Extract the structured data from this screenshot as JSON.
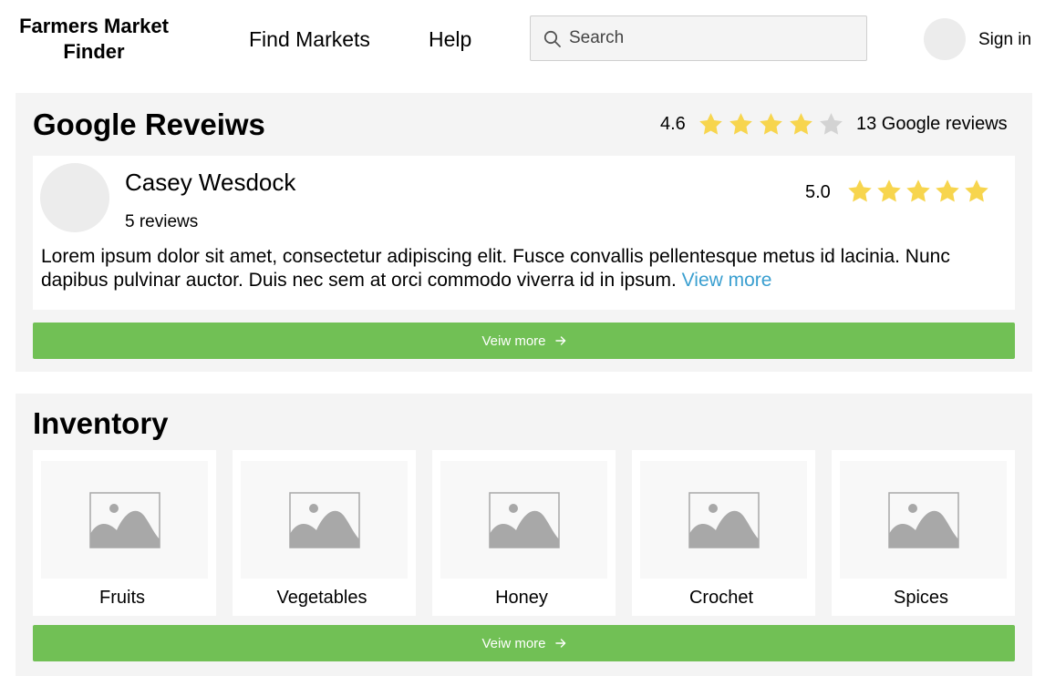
{
  "header": {
    "brand_line1": "Farmers Market",
    "brand_line2": "Finder",
    "nav": [
      {
        "label": "Find Markets"
      },
      {
        "label": "Help"
      }
    ],
    "search_placeholder": "Search",
    "sign_in": "Sign in"
  },
  "reviews": {
    "title": "Google Reveiws",
    "overall_rating": "4.6",
    "overall_stars_filled": 4,
    "overall_stars_total": 5,
    "count_text": "13 Google reviews",
    "review": {
      "name": "Casey Wesdock",
      "reviews_count": "5 reviews",
      "rating": "5.0",
      "stars_filled": 5,
      "text": "Lorem ipsum dolor sit amet, consectetur adipiscing elit. Fusce convallis pellentesque metus id lacinia. Nunc dapibus pulvinar auctor. Duis nec sem at orci commodo viverra id in ipsum.",
      "view_more_link": "View more"
    },
    "button_label": "Veiw more"
  },
  "inventory": {
    "title": "Inventory",
    "items": [
      {
        "label": "Fruits"
      },
      {
        "label": "Vegetables"
      },
      {
        "label": "Honey"
      },
      {
        "label": "Crochet"
      },
      {
        "label": "Spices"
      }
    ],
    "button_label": "Veiw more"
  },
  "colors": {
    "accent_green": "#71c055",
    "star_filled": "#f7d54e",
    "star_empty": "#d3d3d3",
    "link_blue": "#3a9fd0",
    "panel_bg": "#f4f4f4"
  },
  "icons": {
    "search": "search-icon",
    "star": "star-icon",
    "arrow": "arrow-right-icon",
    "image": "image-placeholder-icon"
  }
}
